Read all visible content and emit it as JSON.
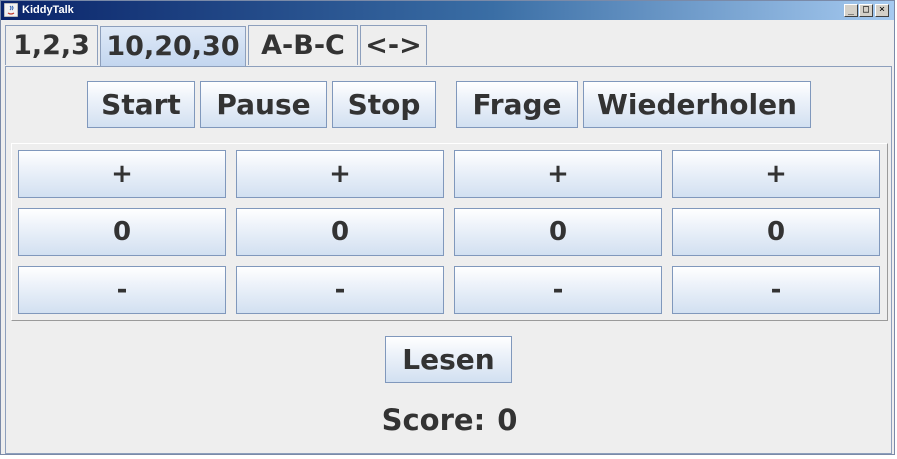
{
  "window": {
    "title": "KiddyTalk"
  },
  "tabs": [
    "1,2,3",
    "10,20,30",
    "A-B-C",
    "<->"
  ],
  "controls": {
    "start": "Start",
    "pause": "Pause",
    "stop": "Stop",
    "frage": "Frage",
    "wiederholen": "Wiederholen"
  },
  "grid": {
    "plus": [
      "+",
      "+",
      "+",
      "+"
    ],
    "values": [
      "0",
      "0",
      "0",
      "0"
    ],
    "minus": [
      "-",
      "-",
      "-",
      "-"
    ]
  },
  "lesen": "Lesen",
  "score": {
    "label": "Score:",
    "value": "0"
  }
}
